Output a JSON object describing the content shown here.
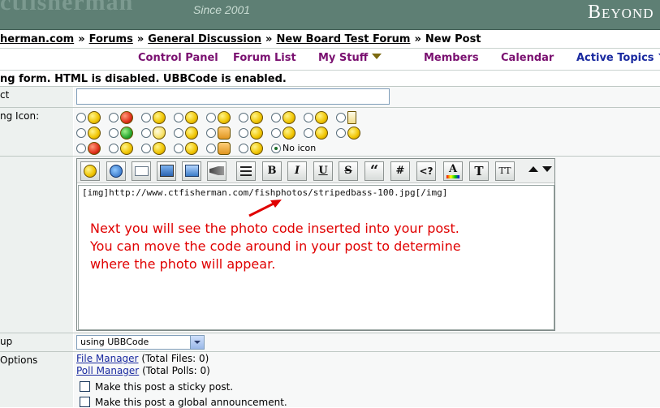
{
  "banner": {
    "logo_text": "ctfisherman",
    "since": "Since 2001",
    "beyond": "Beyond"
  },
  "breadcrumb": {
    "site": "herman.com",
    "forums": "Forums",
    "category": "General Discussion",
    "forum": "New Board Test Forum",
    "current": "New Post",
    "separator": "»"
  },
  "nav": {
    "control_panel": "Control Panel",
    "forum_list": "Forum List",
    "my_stuff": "My Stuff",
    "members": "Members",
    "calendar": "Calendar",
    "active_topics": "Active Topics"
  },
  "info_text": "ng form. HTML is disabled. UBBCode is enabled.",
  "form": {
    "subject_label": "ct",
    "subject_value": "",
    "posting_icon_label": "ng Icon:",
    "no_icon_label": "No icon",
    "markup_label": "up",
    "markup_value": "using UBBCode",
    "options_label": "Options"
  },
  "icons": [
    [
      "confused-smiley",
      "angry-smiley",
      "grin-smiley",
      "cool-smiley",
      "crazy-smiley",
      "shocked-smiley",
      "wink-smiley",
      "smile-smiley",
      "document-icon"
    ],
    [
      "teeth-smiley",
      "sick-smiley",
      "idea-bulb",
      "blush-smiley",
      "thumbs-up-icon",
      "laugh-smiley",
      "grimace-smiley",
      "frown-smiley",
      "sleepy-smiley"
    ],
    [
      "mad-smiley",
      "eek-smiley",
      "tongue-smiley",
      "tired-smiley",
      "thumbs-down-icon",
      "sad-smiley"
    ]
  ],
  "toolbar": {
    "bold": "B",
    "italic": "I",
    "underline": "U",
    "strike": "S",
    "quote": "“",
    "hash": "#",
    "code": "<?",
    "text_size": "T",
    "font_size": "TT"
  },
  "editor": {
    "content": "[img]http://www.ctfisherman.com/fishphotos/stripedbass-100.jpg[/img]",
    "annotation_lines": [
      "Next you will see the photo code inserted into your post.",
      "You can move the code around in your post to determine",
      "where the photo will appear."
    ]
  },
  "options": {
    "file_manager": "File Manager",
    "file_count": "(Total Files: 0)",
    "poll_manager": "Poll Manager",
    "poll_count": "(Total Polls: 0)",
    "sticky_label": "Make this post a sticky post.",
    "global_label": "Make this post a global announcement."
  },
  "colors": {
    "banner": "#5e7f74",
    "nav_purple": "#7a1070",
    "nav_blue": "#1a2aa0",
    "annotation_red": "#e00000"
  }
}
